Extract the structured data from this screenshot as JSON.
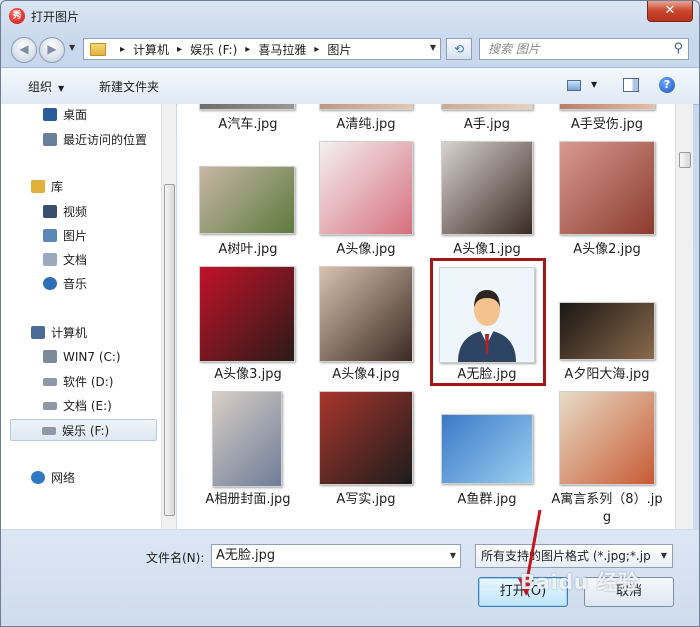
{
  "window": {
    "title": "打开图片",
    "close_label": "✕"
  },
  "nav": {
    "back_icon": "arrow-left-icon",
    "forward_icon": "arrow-right-icon",
    "breadcrumb": [
      "计算机",
      "娱乐 (F:)",
      "喜马拉雅",
      "图片"
    ],
    "search_placeholder": "搜索 图片"
  },
  "toolbar": {
    "organize": "组织",
    "new_folder": "新建文件夹"
  },
  "sidebar": {
    "items": [
      {
        "label": "桌面",
        "icon": "desktop-icon",
        "color": "#2d5c9c"
      },
      {
        "label": "最近访问的位置",
        "icon": "recent-places-icon",
        "color": "#6a7f99"
      },
      {
        "label": "库",
        "icon": "library-icon",
        "color": "#e0b03d"
      },
      {
        "label": "视频",
        "icon": "video-icon",
        "color": "#3a4f6e"
      },
      {
        "label": "图片",
        "icon": "pictures-icon",
        "color": "#5a88b8"
      },
      {
        "label": "文档",
        "icon": "documents-icon",
        "color": "#9aa9bd"
      },
      {
        "label": "音乐",
        "icon": "music-icon",
        "color": "#2f6fb8"
      },
      {
        "label": "计算机",
        "icon": "computer-icon",
        "color": "#4a6d98"
      },
      {
        "label": "WIN7 (C:)",
        "icon": "system-drive-icon",
        "color": "#7d8a9a"
      },
      {
        "label": "软件 (D:)",
        "icon": "drive-icon",
        "color": "#8d98a6"
      },
      {
        "label": "文档 (E:)",
        "icon": "drive-icon",
        "color": "#8d98a6"
      },
      {
        "label": "娱乐 (F:)",
        "icon": "drive-icon",
        "color": "#8d98a6"
      },
      {
        "label": "网络",
        "icon": "network-icon",
        "color": "#2f79c4"
      }
    ],
    "selected": "娱乐 (F:)"
  },
  "files": [
    {
      "name": "A汽车.jpg",
      "colors": [
        "#6c6a68",
        "#9b9995"
      ]
    },
    {
      "name": "A清纯.jpg",
      "colors": [
        "#b9947e",
        "#e4c9b4"
      ]
    },
    {
      "name": "A手.jpg",
      "colors": [
        "#c9a88e",
        "#e8d3c1"
      ]
    },
    {
      "name": "A手受伤.jpg",
      "colors": [
        "#b27a64",
        "#e8c0a8"
      ]
    },
    {
      "name": "A树叶.jpg",
      "colors": [
        "#c6b7a6",
        "#5d7a3c"
      ]
    },
    {
      "name": "A头像.jpg",
      "colors": [
        "#f4f1f1",
        "#d66f7e"
      ]
    },
    {
      "name": "A头像1.jpg",
      "colors": [
        "#d8d2cf",
        "#3a2a24"
      ]
    },
    {
      "name": "A头像2.jpg",
      "colors": [
        "#d99a92",
        "#8b3b2c"
      ]
    },
    {
      "name": "A头像3.jpg",
      "colors": [
        "#c2122a",
        "#2a1b18"
      ]
    },
    {
      "name": "A头像4.jpg",
      "colors": [
        "#d8c1b0",
        "#3a2a22"
      ]
    },
    {
      "name": "A无脸.jpg",
      "colors": [
        "#d7e8f6",
        "#2b3e5a"
      ]
    },
    {
      "name": "A夕阳大海.jpg",
      "colors": [
        "#1a1714",
        "#8a6a4c"
      ]
    },
    {
      "name": "A相册封面.jpg",
      "colors": [
        "#d8cfc6",
        "#6e7c98"
      ]
    },
    {
      "name": "A写实.jpg",
      "colors": [
        "#a8362c",
        "#1c1c1c"
      ]
    },
    {
      "name": "A鱼群.jpg",
      "colors": [
        "#3c78c8",
        "#9ad0f0"
      ]
    },
    {
      "name": "A寓言系列（8）.jpg",
      "colors": [
        "#e6dcc6",
        "#c85a34"
      ]
    }
  ],
  "selected_file": "A无脸.jpg",
  "bottom": {
    "filename_label": "文件名(N):",
    "filename_value": "A无脸.jpg",
    "filter_value": "所有支持的图片格式 (*.jpg;*.jp",
    "open_label": "打开(O)",
    "cancel_label": "取消"
  },
  "watermark": "Baidu 经验"
}
